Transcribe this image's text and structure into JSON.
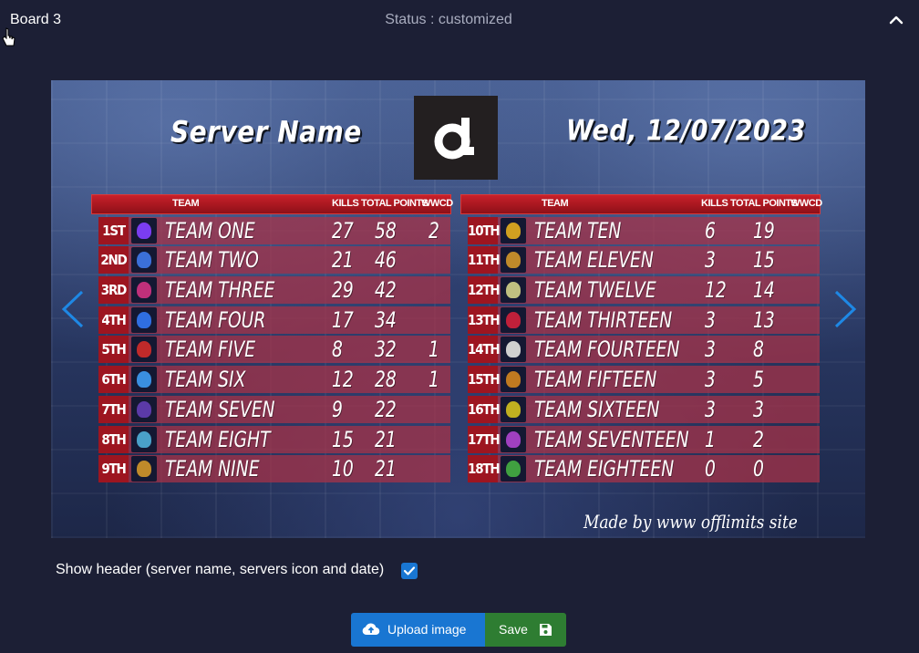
{
  "header": {
    "board_title": "Board 3",
    "status": "Status : customized",
    "collapse_icon": "chevron-up-icon"
  },
  "preview": {
    "server_name": "Server Name",
    "date": "Wed, 12/07/2023",
    "logo": "server-logo",
    "columns": {
      "team": "TEAM",
      "kills": "KILLS",
      "total_points": "TOTAL POINTS",
      "wwcd": "WWCD"
    },
    "left_table": [
      {
        "rank": "1ST",
        "team": "TEAM ONE",
        "kills": "27",
        "points": "58",
        "wwcd": "2"
      },
      {
        "rank": "2ND",
        "team": "TEAM TWO",
        "kills": "21",
        "points": "46",
        "wwcd": ""
      },
      {
        "rank": "3RD",
        "team": "TEAM THREE",
        "kills": "29",
        "points": "42",
        "wwcd": ""
      },
      {
        "rank": "4TH",
        "team": "TEAM FOUR",
        "kills": "17",
        "points": "34",
        "wwcd": ""
      },
      {
        "rank": "5TH",
        "team": "TEAM FIVE",
        "kills": "8",
        "points": "32",
        "wwcd": "1"
      },
      {
        "rank": "6TH",
        "team": "TEAM SIX",
        "kills": "12",
        "points": "28",
        "wwcd": "1"
      },
      {
        "rank": "7TH",
        "team": "TEAM SEVEN",
        "kills": "9",
        "points": "22",
        "wwcd": ""
      },
      {
        "rank": "8TH",
        "team": "TEAM EIGHT",
        "kills": "15",
        "points": "21",
        "wwcd": ""
      },
      {
        "rank": "9TH",
        "team": "TEAM NINE",
        "kills": "10",
        "points": "21",
        "wwcd": ""
      }
    ],
    "right_table": [
      {
        "rank": "10TH",
        "team": "TEAM TEN",
        "kills": "6",
        "points": "19",
        "wwcd": ""
      },
      {
        "rank": "11TH",
        "team": "TEAM ELEVEN",
        "kills": "3",
        "points": "15",
        "wwcd": ""
      },
      {
        "rank": "12TH",
        "team": "TEAM TWELVE",
        "kills": "12",
        "points": "14",
        "wwcd": ""
      },
      {
        "rank": "13TH",
        "team": "TEAM THIRTEEN",
        "kills": "3",
        "points": "13",
        "wwcd": ""
      },
      {
        "rank": "14TH",
        "team": "TEAM FOURTEEN",
        "kills": "3",
        "points": "8",
        "wwcd": ""
      },
      {
        "rank": "15TH",
        "team": "TEAM FIFTEEN",
        "kills": "3",
        "points": "5",
        "wwcd": ""
      },
      {
        "rank": "16TH",
        "team": "TEAM SIXTEEN",
        "kills": "3",
        "points": "3",
        "wwcd": ""
      },
      {
        "rank": "17TH",
        "team": "TEAM SEVENTEEN",
        "kills": "1",
        "points": "2",
        "wwcd": ""
      },
      {
        "rank": "18TH",
        "team": "TEAM EIGHTEEN",
        "kills": "0",
        "points": "0",
        "wwcd": ""
      }
    ],
    "made_by": "Made by www offlimits site",
    "icon_colors": [
      "#7a3df0",
      "#3b6fd8",
      "#c0307a",
      "#2f6ee0",
      "#c02a2a",
      "#3a8fe0",
      "#5b3aa8",
      "#4aa0c8",
      "#c08a2a",
      "#d0a020",
      "#c08a2a",
      "#c0c080",
      "#c0203a",
      "#d0d0d0",
      "#c07a20",
      "#c0b020",
      "#a040c0",
      "#40a040"
    ],
    "prev_icon": "chevron-left-icon",
    "next_icon": "chevron-right-icon"
  },
  "options": {
    "show_header_label": "Show header (server name, servers icon and date)",
    "show_header_checked": true
  },
  "actions": {
    "upload_label": "Upload image",
    "upload_icon": "cloud-upload-icon",
    "save_label": "Save",
    "save_icon": "floppy-disk-icon"
  },
  "colors": {
    "page_bg": "#1c1f35",
    "primary": "#1976d2",
    "success": "#2e7d32",
    "rank_red": "#9d1520"
  }
}
